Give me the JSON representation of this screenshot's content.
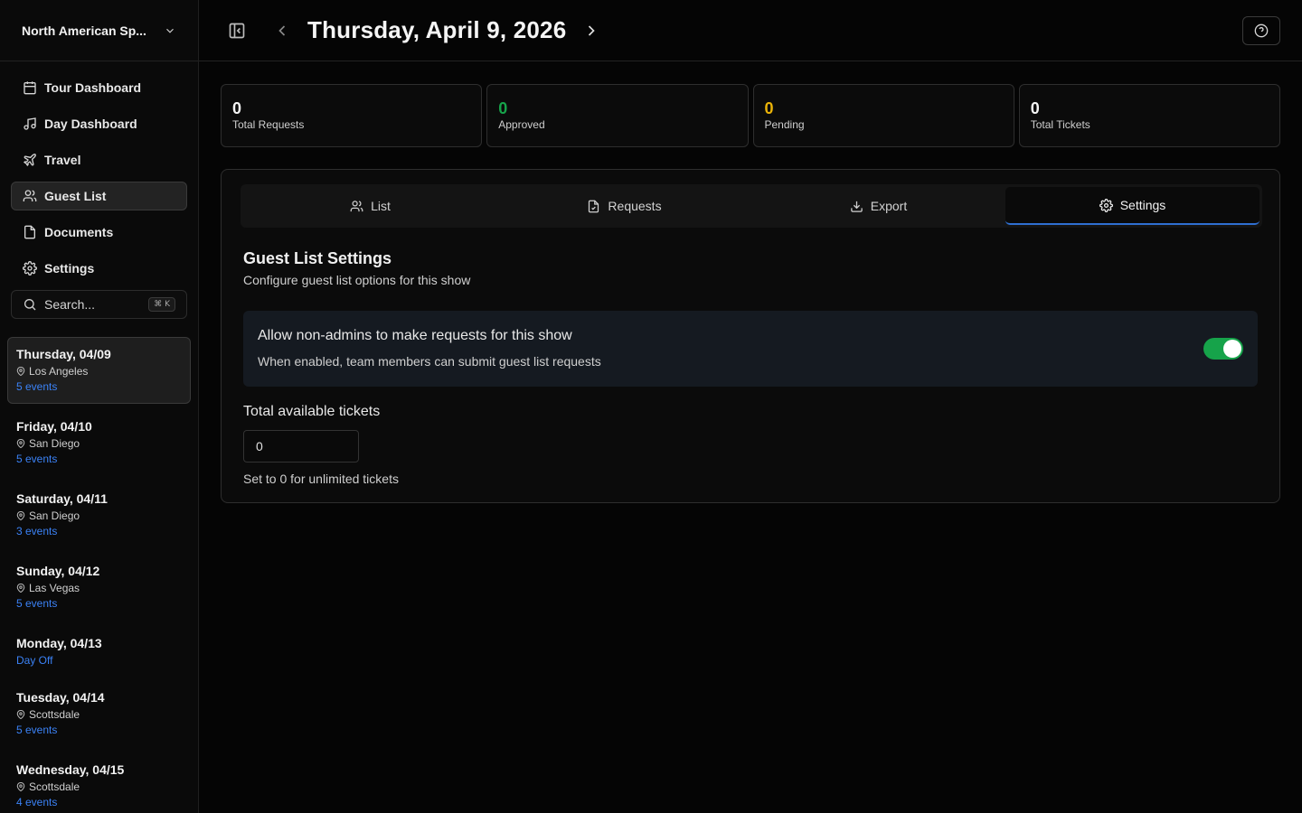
{
  "sidebar": {
    "org_name": "North American Sp...",
    "nav": [
      {
        "label": "Tour Dashboard",
        "icon": "calendar-icon"
      },
      {
        "label": "Day Dashboard",
        "icon": "music-note-icon"
      },
      {
        "label": "Travel",
        "icon": "plane-icon"
      },
      {
        "label": "Guest List",
        "icon": "users-icon",
        "active": true
      },
      {
        "label": "Documents",
        "icon": "document-icon"
      },
      {
        "label": "Settings",
        "icon": "gear-icon"
      }
    ],
    "search": {
      "placeholder": "Search...",
      "shortcut": "⌘ K"
    },
    "days": [
      {
        "date": "Thursday, 04/09",
        "location": "Los Angeles",
        "events": "5 events",
        "active": true
      },
      {
        "date": "Friday, 04/10",
        "location": "San Diego",
        "events": "5 events"
      },
      {
        "date": "Saturday, 04/11",
        "location": "San Diego",
        "events": "3 events"
      },
      {
        "date": "Sunday, 04/12",
        "location": "Las Vegas",
        "events": "5 events"
      },
      {
        "date": "Monday, 04/13",
        "location": "",
        "events": "Day Off"
      },
      {
        "date": "Tuesday, 04/14",
        "location": "Scottsdale",
        "events": "5 events"
      },
      {
        "date": "Wednesday, 04/15",
        "location": "Scottsdale",
        "events": "4 events"
      }
    ]
  },
  "header": {
    "title": "Thursday, April 9, 2026"
  },
  "stats": [
    {
      "value": "0",
      "label": "Total Requests",
      "color": "#f5f5f5"
    },
    {
      "value": "0",
      "label": "Approved",
      "color": "#16a34a"
    },
    {
      "value": "0",
      "label": "Pending",
      "color": "#eab308"
    },
    {
      "value": "0",
      "label": "Total Tickets",
      "color": "#f5f5f5"
    }
  ],
  "tabs": [
    {
      "label": "List",
      "icon": "users-icon"
    },
    {
      "label": "Requests",
      "icon": "file-icon"
    },
    {
      "label": "Export",
      "icon": "download-icon"
    },
    {
      "label": "Settings",
      "icon": "gear-icon",
      "active": true
    }
  ],
  "settings": {
    "title": "Guest List Settings",
    "subtitle": "Configure guest list options for this show",
    "toggle": {
      "title": "Allow non-admins to make requests for this show",
      "description": "When enabled, team members can submit guest list requests",
      "enabled": true
    },
    "tickets_label": "Total available tickets",
    "tickets_value": "0",
    "tickets_hint": "Set to 0 for unlimited tickets"
  },
  "colors": {
    "accent_blue": "#3b82f6",
    "toggle_on": "#16a34a",
    "approved": "#16a34a",
    "pending": "#eab308"
  }
}
